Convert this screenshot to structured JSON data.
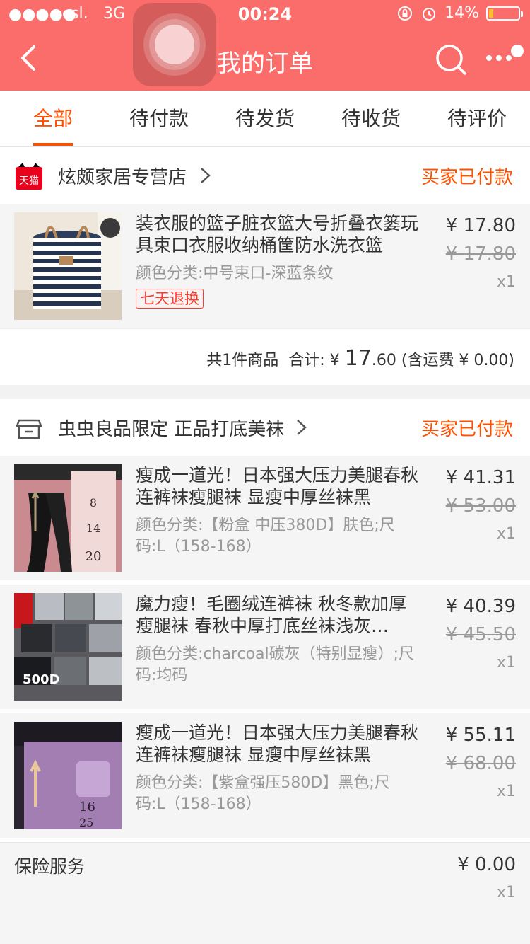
{
  "status_bar": {
    "signal": "●●●●●",
    "carrier": "csl.",
    "network": "3G",
    "time": "00:24",
    "battery": "14%",
    "battery_level": 0.14
  },
  "nav": {
    "title": "我的订单"
  },
  "tabs": [
    {
      "label": "全部",
      "active": true
    },
    {
      "label": "待付款"
    },
    {
      "label": "待发货"
    },
    {
      "label": "待收货"
    },
    {
      "label": "待评价"
    }
  ],
  "orders": [
    {
      "shop_name": "炫颇家居专营店",
      "shop_badge": "天猫",
      "status": "买家已付款",
      "items": [
        {
          "title": "装衣服的篮子脏衣篮大号折叠衣篓玩具束口衣服收纳桶筐防水洗衣篮",
          "sku": "颜色分类:中号束口-深蓝条纹",
          "tag": "七天退换",
          "price": "¥ 17.80",
          "original_price": "¥ 17.80",
          "qty": "x1"
        }
      ],
      "summary": {
        "count_text": "共1件商品",
        "total_label": "合计:",
        "currency": "¥",
        "total_int": "17",
        "total_dec": ".60",
        "shipping": "(含运费 ¥ 0.00)"
      }
    },
    {
      "shop_name": "虫虫良品限定 正品打底美袜",
      "status": "买家已付款",
      "items": [
        {
          "title": "瘦成一道光！日本强大压力美腿春秋连裤袜瘦腿袜 显瘦中厚丝袜黑",
          "sku": "颜色分类:【粉盒 中压380D】肤色;尺码:L（158-168）",
          "price": "¥ 41.31",
          "original_price": "¥ 53.00",
          "qty": "x1"
        },
        {
          "title": "魔力瘦！毛圈绒连裤袜 秋冬款加厚瘦腿袜 春秋中厚打底丝袜浅灰…",
          "sku": "颜色分类:charcoal碳灰（特别显瘦）;尺码:均码",
          "price": "¥ 40.39",
          "original_price": "¥ 45.50",
          "qty": "x1"
        },
        {
          "title": "瘦成一道光！日本强大压力美腿春秋连裤袜瘦腿袜 显瘦中厚丝袜黑",
          "sku": "颜色分类:【紫盒强压580D】黑色;尺码:L（158-168）",
          "price": "¥ 55.11",
          "original_price": "¥ 68.00",
          "qty": "x1"
        }
      ]
    }
  ],
  "insurance": {
    "label": "保险服务",
    "price": "¥ 0.00",
    "qty": "x1"
  },
  "colors": {
    "header": "#fb6d6b",
    "accent": "#ff5000",
    "tag_red": "#ff3b30"
  }
}
